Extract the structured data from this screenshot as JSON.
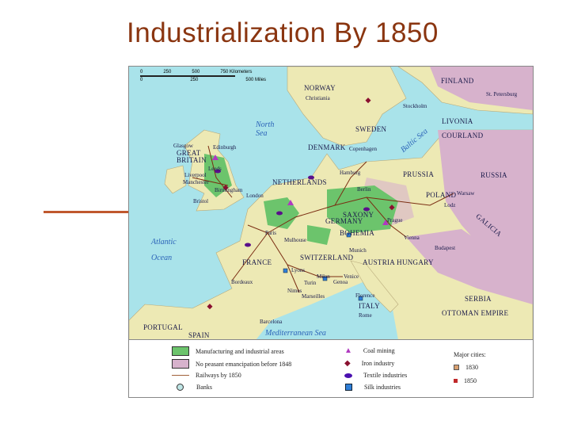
{
  "title": "Industrialization By 1850",
  "colors": {
    "title": "#8a3510",
    "sea": "#a9e3ea",
    "land": "#ede9b4",
    "no_emancipation": "#d7b2cc",
    "industrial": "#6cc46c",
    "railway": "#7a2d12"
  },
  "scale": {
    "km": [
      "0",
      "250",
      "500",
      "750 Kilometers"
    ],
    "miles": [
      "0",
      "250",
      "500 Miles"
    ]
  },
  "map": {
    "labels": [
      "NORWAY",
      "FINLAND",
      "St. Petersburg",
      "Christiania",
      "Stockholm",
      "LIVONIA",
      "COURLAND",
      "SWEDEN",
      "North Sea",
      "DENMARK",
      "Copenhagen",
      "Baltic Sea",
      "GREAT BRITAIN",
      "Glasgow",
      "Edinburgh",
      "Leeds",
      "Liverpool",
      "Manchester",
      "Birmingham",
      "Bristol",
      "London",
      "NETHERLANDS",
      "Hamburg",
      "Berlin",
      "PRUSSIA",
      "RUSSIA",
      "Warsaw",
      "POLAND",
      "Lodz",
      "SAXONY",
      "GERMANY",
      "Prague",
      "BOHEMIA",
      "GALICIA",
      "Vienna",
      "Budapest",
      "Paris",
      "Mulhouse",
      "Munich",
      "FRANCE",
      "SWITZERLAND",
      "AUSTRIA HUNGARY",
      "Atlantic Ocean",
      "Lyons",
      "Milan",
      "Turin",
      "Venice",
      "Genoa",
      "Bordeaux",
      "Nimes",
      "Marseilles",
      "Florence",
      "ITALY",
      "Rome",
      "SERBIA",
      "OTTOMAN EMPIRE",
      "PORTUGAL",
      "SPAIN",
      "Barcelona",
      "Mediterranean Sea"
    ]
  },
  "legend": {
    "items": [
      "Manufacturing and industrial areas",
      "No peasant emancipation before 1848",
      "Railways by 1850",
      "Banks",
      "Coal mining",
      "Iron industry",
      "Textile industries",
      "Silk industries"
    ],
    "major_cities_title": "Major cities:",
    "cities": [
      "1830",
      "1850"
    ]
  }
}
